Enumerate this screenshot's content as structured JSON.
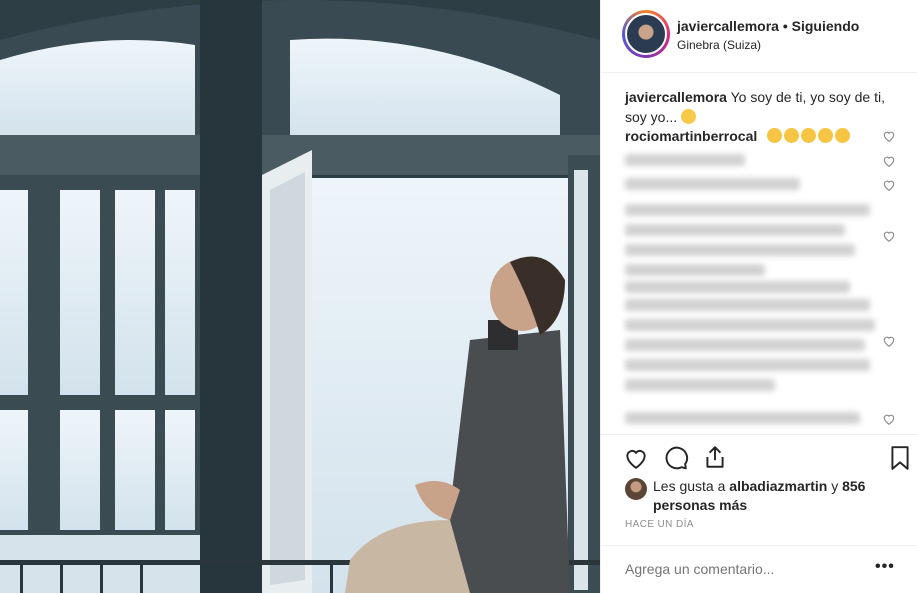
{
  "header": {
    "username": "javiercallemora",
    "separator": "•",
    "follow_status": "Siguiendo",
    "location": "Ginebra (Suiza)"
  },
  "caption": {
    "username": "javiercallemora",
    "text": "Yo soy de ti, yo soy de ti, soy yo..."
  },
  "comments": [
    {
      "username": "rociomartinberrocal",
      "text": ""
    }
  ],
  "likes": {
    "prefix": "Les gusta a",
    "user": "albadiazmartin",
    "conj": "y",
    "count": "856 personas más"
  },
  "timestamp": "HACE UN DÍA",
  "add_comment": {
    "placeholder": "Agrega un comentario..."
  },
  "more_label": "•••",
  "icons": {
    "like": "heart-icon",
    "comment": "comment-icon",
    "share": "share-icon",
    "save": "bookmark-icon"
  },
  "colors": {
    "accent": "#262626",
    "muted": "#8e8e8e",
    "border": "#efefef"
  }
}
